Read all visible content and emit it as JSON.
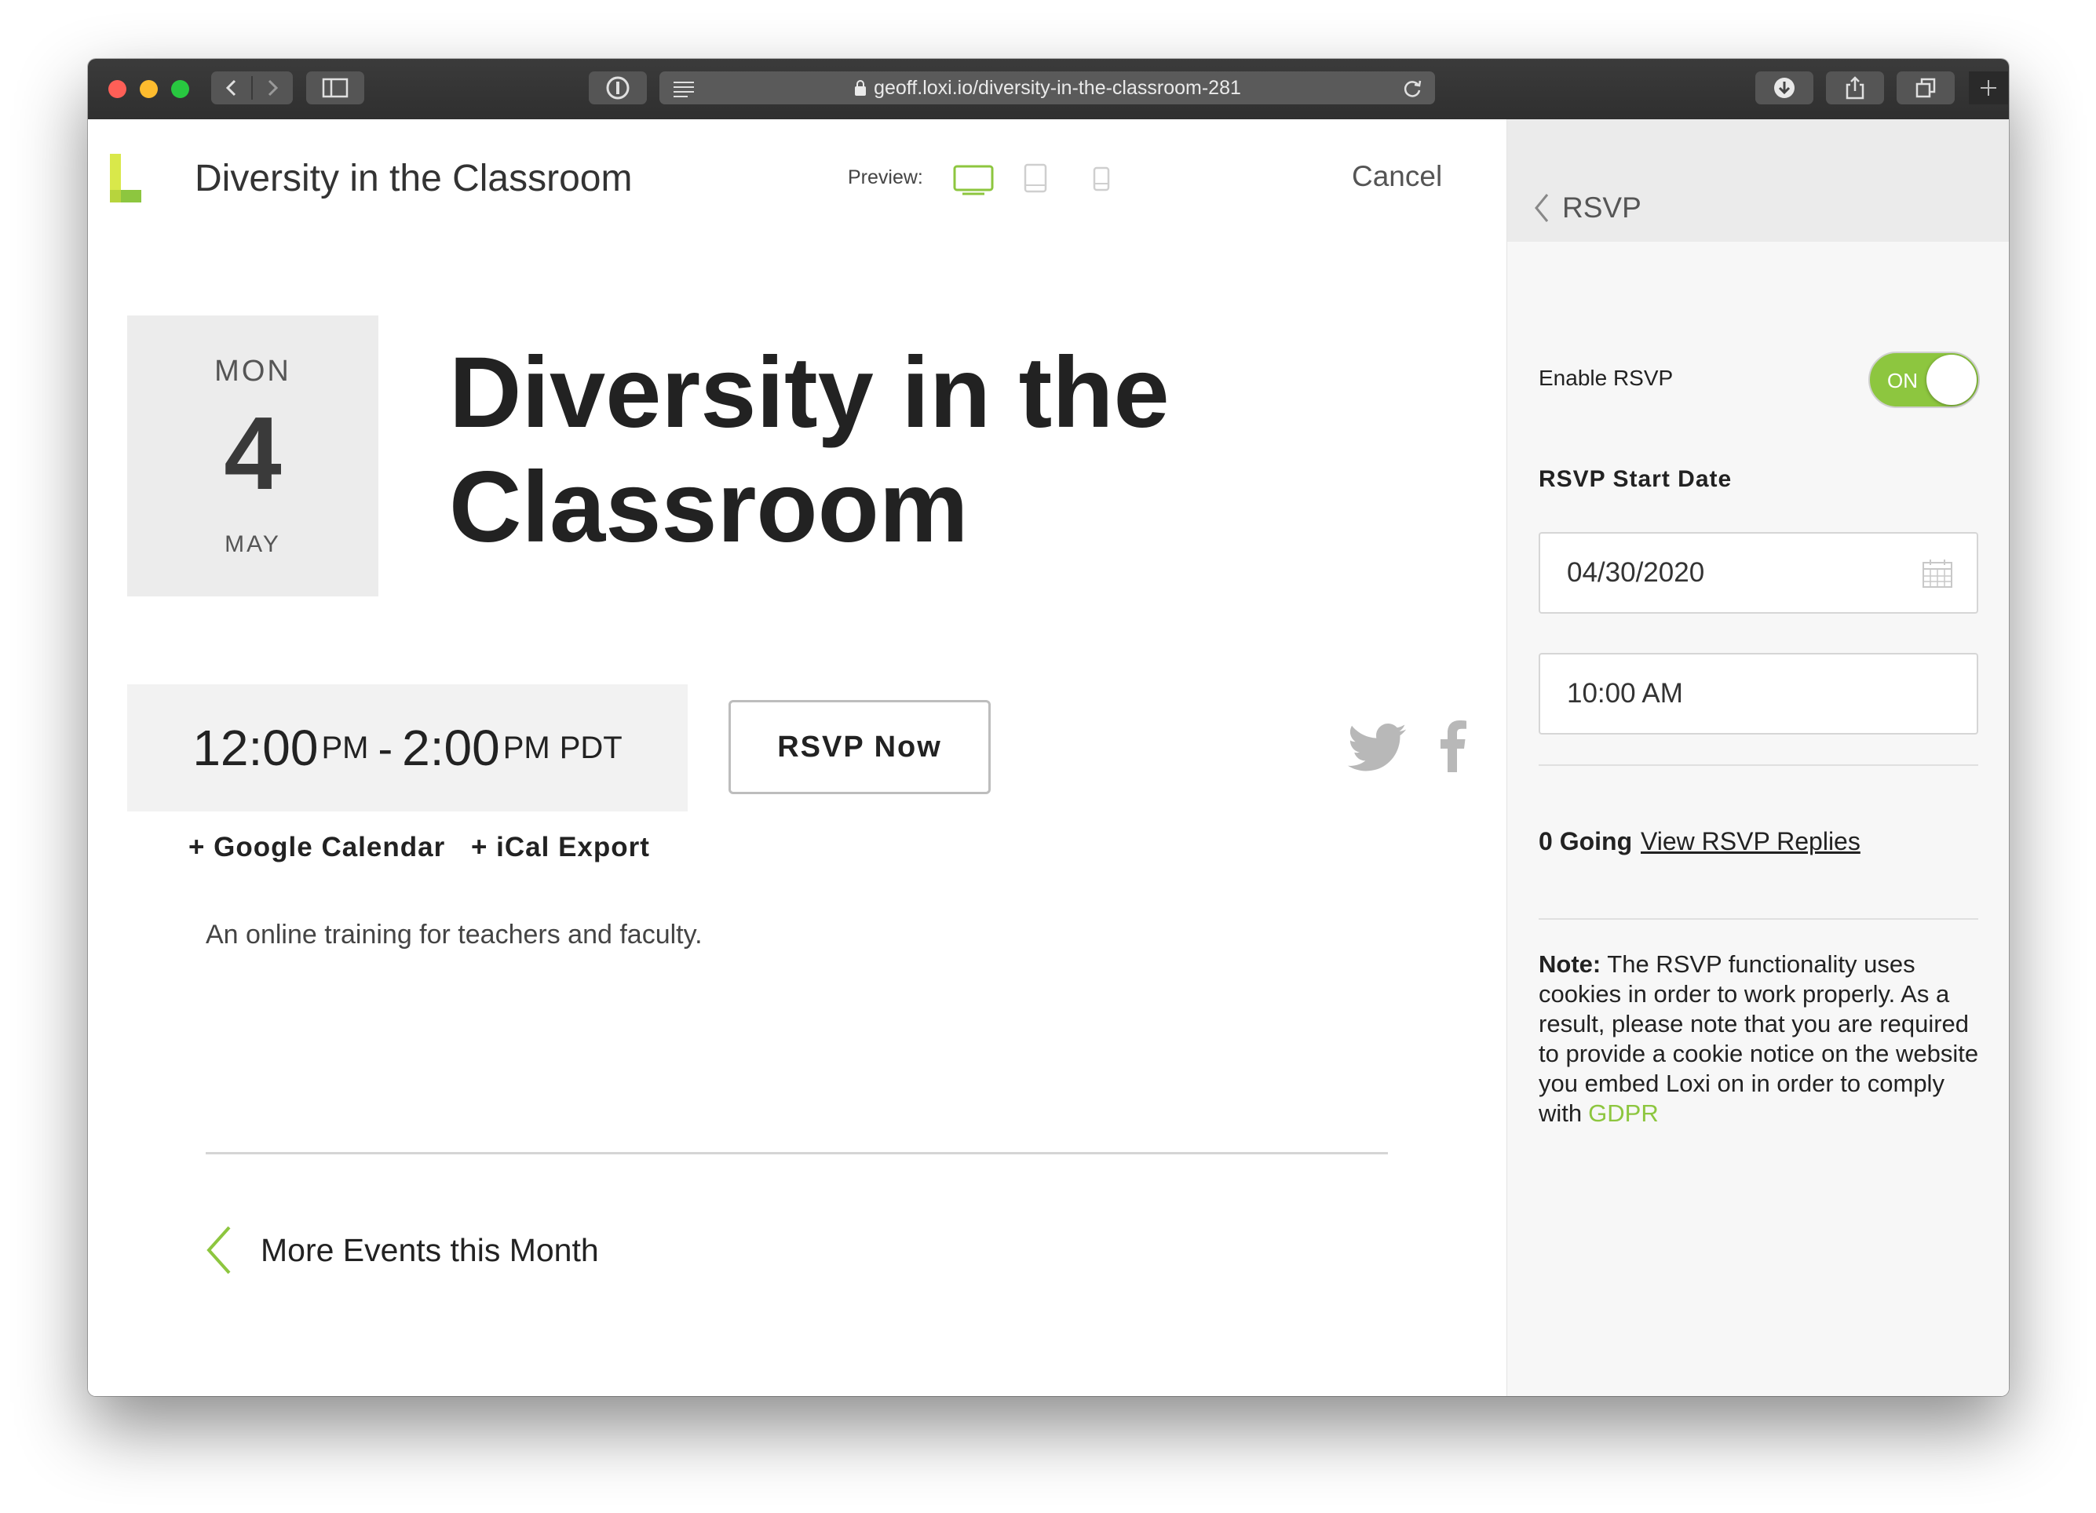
{
  "browser": {
    "url": "geoff.loxi.io/diversity-in-the-classroom-281",
    "traffic_lights": {
      "close": "#ff5f57",
      "minimize": "#febc2e",
      "zoom": "#28c840"
    }
  },
  "header": {
    "app_title": "Diversity in the Classroom",
    "preview_label": "Preview:",
    "cancel_label": "Cancel",
    "active_device": "desktop"
  },
  "event": {
    "date": {
      "weekday": "MON",
      "day": "4",
      "month": "MAY"
    },
    "title": "Diversity in the Classroom",
    "time": {
      "start": "12:00",
      "start_period": "PM",
      "separator": "-",
      "end": "2:00",
      "end_period": "PM",
      "timezone": "PDT"
    },
    "rsvp_button": "RSVP Now",
    "calendar_links": [
      "+ Google Calendar",
      "+ iCal Export"
    ],
    "description": "An online training for teachers and faculty.",
    "more_events": "More Events this Month"
  },
  "panel": {
    "title": "RSVP",
    "enable_label": "Enable RSVP",
    "toggle_state": "ON",
    "start_date_label": "RSVP Start Date",
    "date_value": "04/30/2020",
    "time_value": "10:00 AM",
    "going": "0 Going",
    "view_replies": "View RSVP Replies",
    "note_bold": "Note:",
    "note_text": "The RSVP functionality uses cookies in order to work properly. As a result, please note that you are required to provide a cookie notice on the website you embed Loxi on in order to comply with",
    "note_link": "GDPR"
  },
  "colors": {
    "accent": "#8dc63f",
    "logo_light": "#d9e84a",
    "logo_dark": "#8dc63f"
  }
}
